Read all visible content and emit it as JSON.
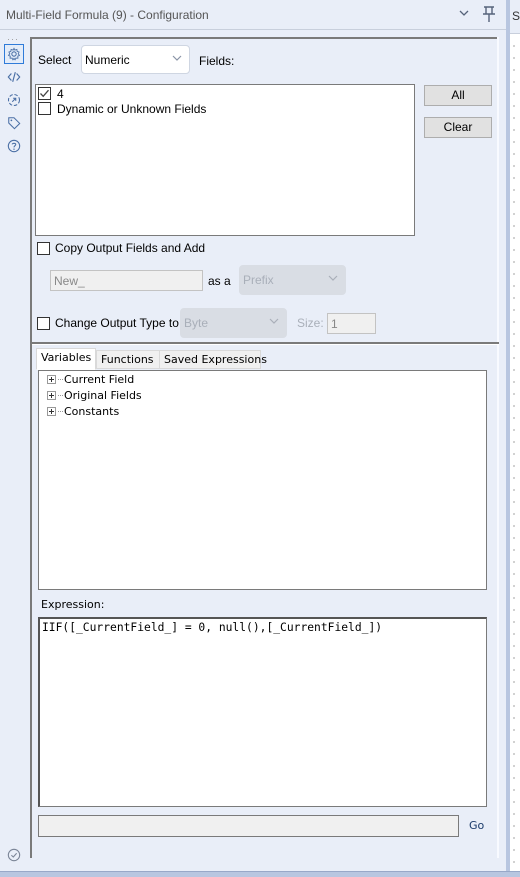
{
  "window": {
    "title": "Multi-Field Formula (9) - Configuration",
    "collapse_icon": "chevron-down-icon",
    "pin_icon": "pin-icon",
    "right_panel_initial": "S"
  },
  "sidebar": {
    "items": [
      {
        "name": "configuration",
        "icon": "gear-icon",
        "active": true
      },
      {
        "name": "code",
        "icon": "code-icon",
        "active": false
      },
      {
        "name": "annotation",
        "icon": "annotation-icon",
        "active": false
      },
      {
        "name": "tag",
        "icon": "tag-icon",
        "active": false
      },
      {
        "name": "help",
        "icon": "help-icon",
        "active": false
      }
    ],
    "bottom_icon": "check-circle-icon"
  },
  "select_row": {
    "label": "Select",
    "value": "Numeric",
    "fields_label": "Fields:"
  },
  "fields_list": [
    {
      "label": "4",
      "checked": true
    },
    {
      "label": "Dynamic or Unknown Fields",
      "checked": false
    }
  ],
  "buttons": {
    "all": "All",
    "clear": "Clear",
    "go": "Go"
  },
  "copy_output": {
    "label": "Copy Output Fields and Add",
    "checked": false,
    "name_value": "New_",
    "as_a_label": "as a",
    "position_value": "Prefix"
  },
  "change_type": {
    "label": "Change Output Type to",
    "checked": false,
    "type_value": "Byte",
    "size_label": "Size:",
    "size_value": "1"
  },
  "tabs": [
    {
      "label": "Variables",
      "active": true
    },
    {
      "label": "Functions",
      "active": false
    },
    {
      "label": "Saved Expressions",
      "active": false
    }
  ],
  "tree": [
    {
      "label": "Current Field"
    },
    {
      "label": "Original Fields"
    },
    {
      "label": "Constants"
    }
  ],
  "expression": {
    "label": "Expression:",
    "value": "IIF([_CurrentField_] = 0, null(),[_CurrentField_])"
  },
  "go_input": {
    "value": ""
  }
}
